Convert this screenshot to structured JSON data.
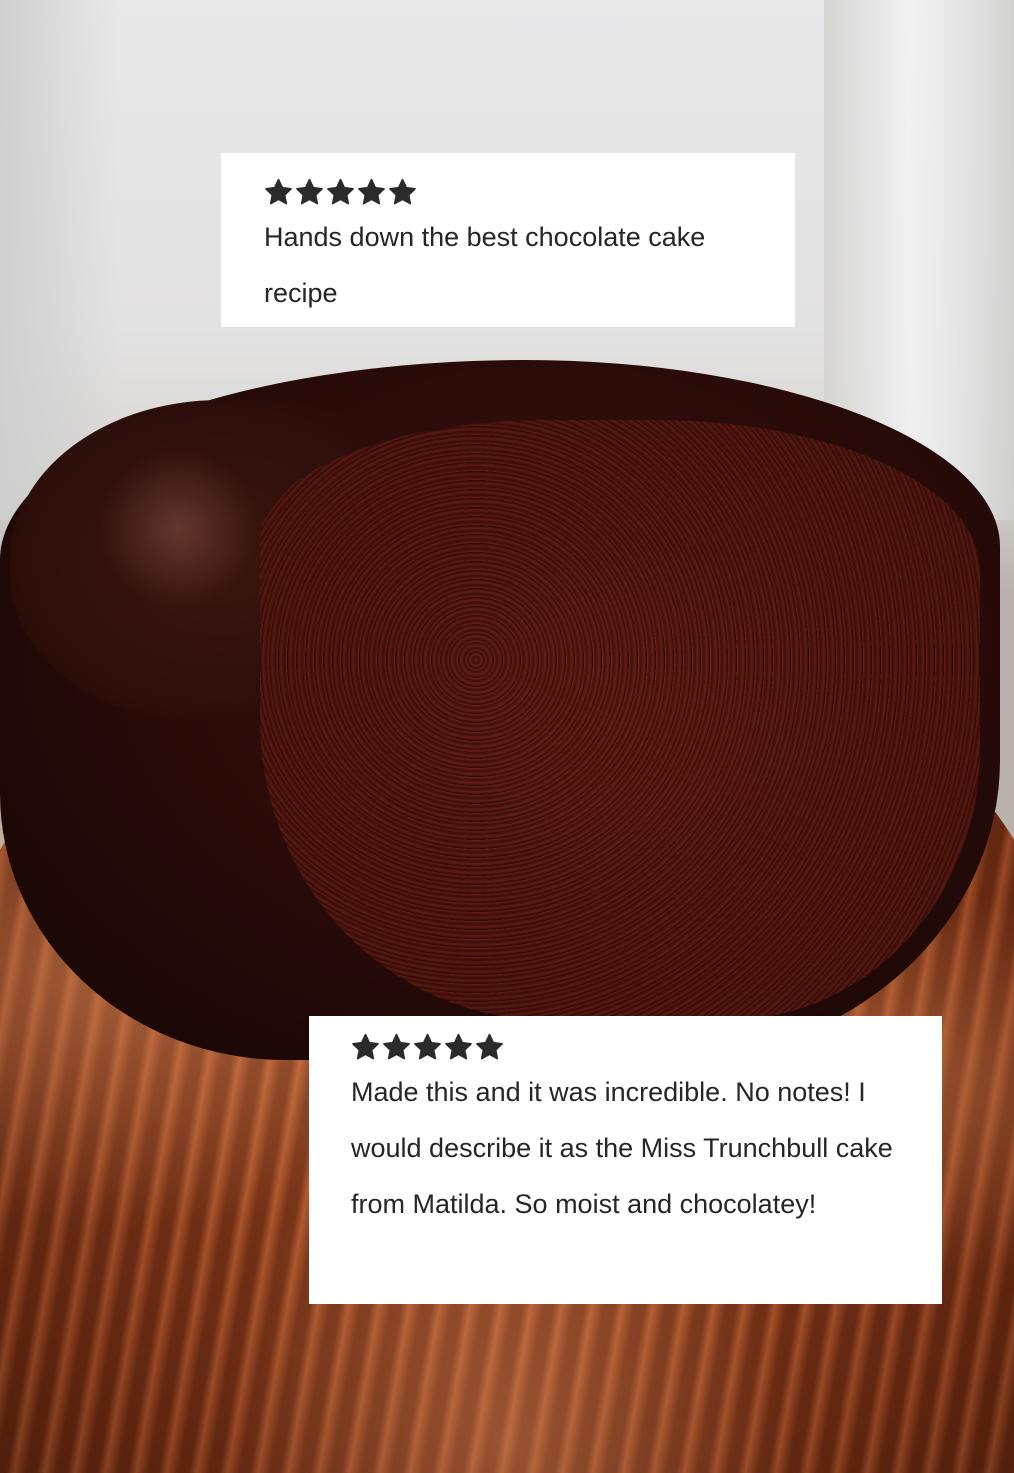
{
  "reviews": [
    {
      "rating": 5,
      "star_icon": "star-icon",
      "text": "Hands down the best chocolate cake recipe"
    },
    {
      "rating": 5,
      "star_icon": "star-icon",
      "text": "Made this and it was incredible. No notes! I would describe it as the Miss Trunchbull cake from Matilda. So moist and chocolatey!"
    }
  ],
  "colors": {
    "card_background": "#ffffff",
    "text": "#262626",
    "star": "#2b2b2b",
    "cake": "#2a0c09",
    "liner": "#a24b25"
  }
}
